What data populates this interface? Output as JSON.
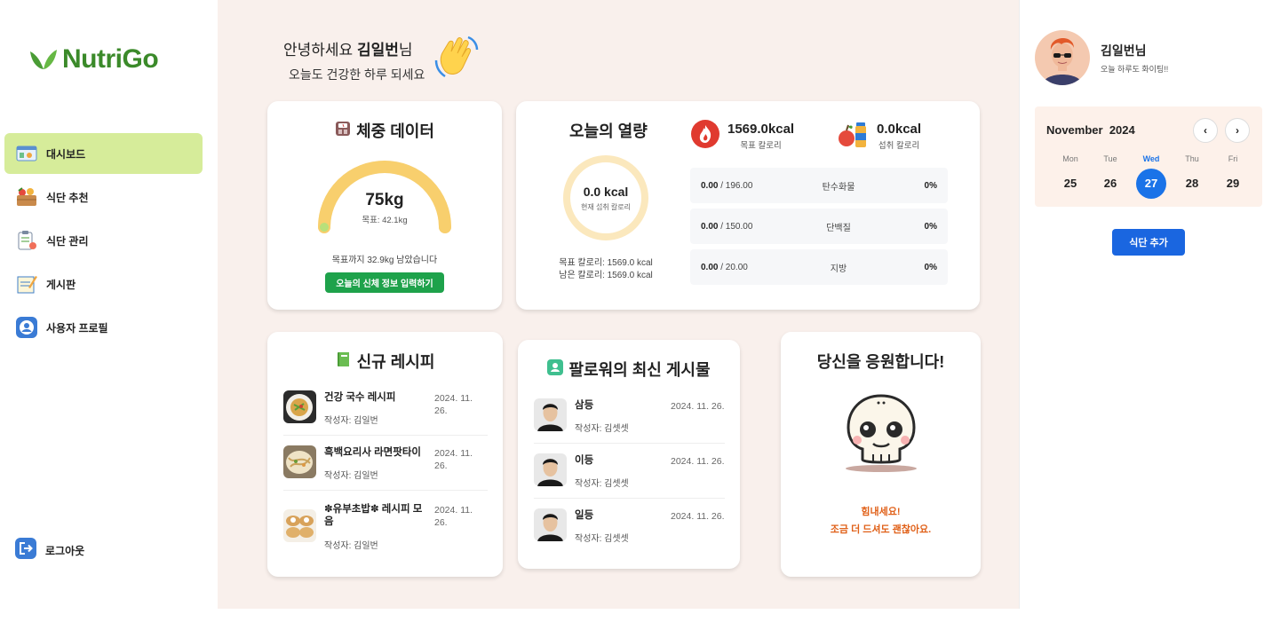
{
  "app": {
    "logo_text": "NutriGo"
  },
  "sidebar": {
    "items": [
      {
        "label": "대시보드",
        "icon": "dashboard-icon",
        "active": true
      },
      {
        "label": "식단 추천",
        "icon": "food-basket-icon",
        "active": false
      },
      {
        "label": "식단 관리",
        "icon": "clipboard-icon",
        "active": false
      },
      {
        "label": "게시판",
        "icon": "notepad-icon",
        "active": false
      },
      {
        "label": "사용자 프로필",
        "icon": "user-profile-icon",
        "active": false
      }
    ],
    "logout_label": "로그아웃"
  },
  "greeting": {
    "prefix": "안녕하세요 ",
    "name": "김일번",
    "suffix": "님",
    "subline": "오늘도 건강한 하루 되세요"
  },
  "weight_card": {
    "title": "체중 데이터",
    "value": "75kg",
    "goal": "목표: 42.1kg",
    "remaining": "목표까지 32.9kg 남았습니다",
    "button": "오늘의 신체 정보 입력하기",
    "progress": 1.0
  },
  "calorie_card": {
    "title": "오늘의 열량",
    "ring_value": "0.0 kcal",
    "ring_label": "현재 섭취 칼로리",
    "ring_progress": 0.0,
    "target_line": "목표 칼로리: 1569.0 kcal",
    "remaining_line": "남은 칼로리: 1569.0 kcal",
    "target_kcal": "1569.0kcal",
    "target_kcal_label": "목표 칼로리",
    "intake_kcal": "0.0kcal",
    "intake_kcal_label": "섭취 칼로리",
    "macros": [
      {
        "current": "0.00",
        "target": " / 196.00",
        "name": "탄수화물",
        "percent": "0%"
      },
      {
        "current": "0.00",
        "target": " / 150.00",
        "name": "단백질",
        "percent": "0%"
      },
      {
        "current": "0.00",
        "target": " / 20.00",
        "name": "지방",
        "percent": "0%"
      }
    ]
  },
  "recipes": {
    "title": "신규 레시피",
    "items": [
      {
        "title": "건강 국수 레시피",
        "date": "2024. 11. 26.",
        "author": "작성자: 김일번"
      },
      {
        "title": "흑백요리사 라면팟타이",
        "date": "2024. 11. 26.",
        "author": "작성자: 김일번"
      },
      {
        "title": "✽유부초밥✽ 레시피 모음",
        "date": "2024. 11. 26.",
        "author": "작성자: 김일번"
      }
    ]
  },
  "follower_posts": {
    "title": "팔로워의 최신 게시물",
    "items": [
      {
        "title": "삼등",
        "date": "2024. 11. 26.",
        "author": "작성자: 김셋셋"
      },
      {
        "title": "이등",
        "date": "2024. 11. 26.",
        "author": "작성자: 김셋셋"
      },
      {
        "title": "일등",
        "date": "2024. 11. 26.",
        "author": "작성자: 김셋셋"
      }
    ]
  },
  "cheer": {
    "title": "당신을 응원합니다!",
    "line1": "힘내세요!",
    "line2": "조금 더 드셔도 괜찮아요."
  },
  "profile": {
    "name": "김일번님",
    "subtitle": "오늘 하루도 화이팅!!"
  },
  "calendar": {
    "month": "November",
    "year": "2024",
    "prev_icon": "chevron-left-icon",
    "next_icon": "chevron-right-icon",
    "days": [
      {
        "name": "Mon",
        "num": "25",
        "today": false
      },
      {
        "name": "Tue",
        "num": "26",
        "today": false
      },
      {
        "name": "Wed",
        "num": "27",
        "today": true
      },
      {
        "name": "Thu",
        "num": "28",
        "today": false
      },
      {
        "name": "Fri",
        "num": "29",
        "today": false
      }
    ],
    "add_button": "식단 추가"
  },
  "colors": {
    "accent_green": "#1ea24b",
    "sidebar_active": "#d6ec9a",
    "main_bg": "#f9f0ec",
    "calendar_bg": "#fdf1ea",
    "primary_blue": "#1a73e8",
    "cheer_orange": "#e06018",
    "gauge": "#f8cf6d"
  }
}
